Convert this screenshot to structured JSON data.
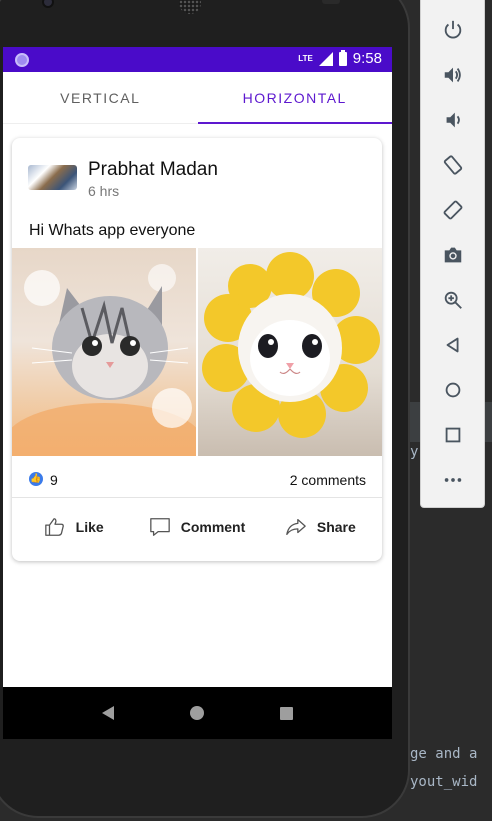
{
  "status_bar": {
    "time": "9:58",
    "network": "LTE"
  },
  "tabs": [
    {
      "label": "VERTICAL",
      "active": false
    },
    {
      "label": "HORIZONTAL",
      "active": true
    }
  ],
  "post": {
    "author": "Prabhat Madan",
    "time_ago": "6 hrs",
    "text": "Hi Whats app everyone",
    "like_count": "9",
    "comments": "2 comments",
    "actions": {
      "like": "Like",
      "comment": "Comment",
      "share": "Share"
    }
  },
  "nav_bar": [
    "back-icon",
    "home-icon",
    "recents-icon"
  ],
  "emulator_panel": {
    "buttons": [
      "power-icon",
      "volume-up-icon",
      "volume-down-icon",
      "rotate-left-icon",
      "rotate-right-icon",
      "camera-icon",
      "zoom-icon",
      "back-icon",
      "home-icon",
      "overview-icon",
      "more-icon"
    ]
  },
  "ide_code": [
    "y",
    "ge and a",
    "yout_wid"
  ],
  "colors": {
    "accent": "#5d18cf",
    "status_bar": "#4a0bc9",
    "like_blue": "#3b7bea"
  }
}
